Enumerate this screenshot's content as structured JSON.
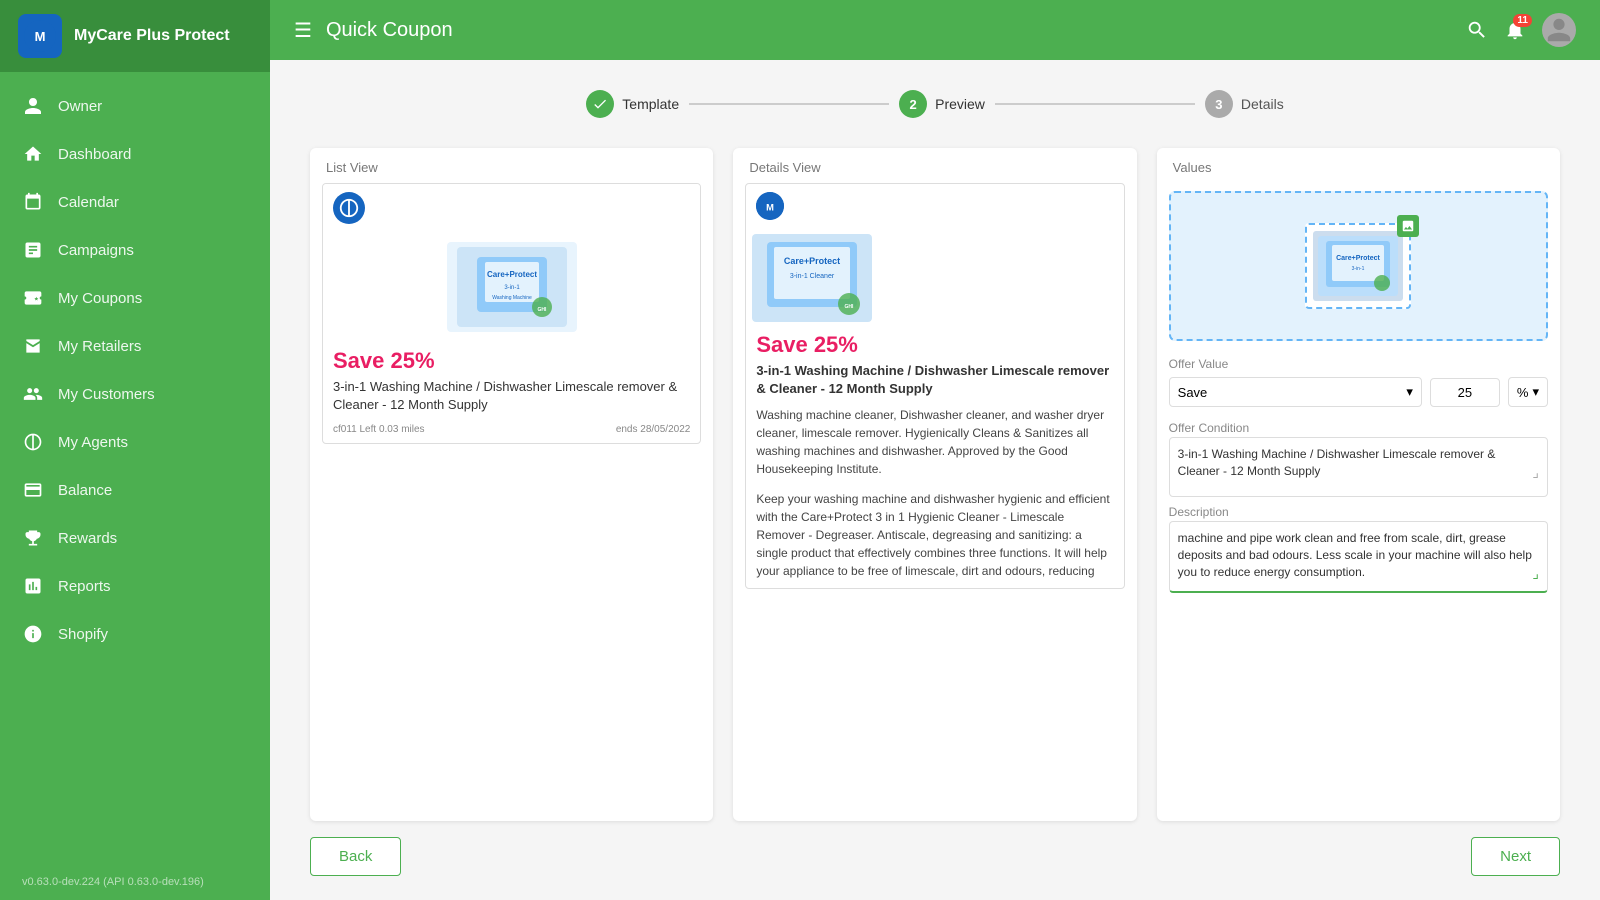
{
  "app": {
    "name": "MyCare Plus Protect",
    "logo_alt": "MyCare Plus logo"
  },
  "topbar": {
    "menu_icon": "☰",
    "title": "Quick Coupon",
    "notification_count": "11"
  },
  "sidebar": {
    "items": [
      {
        "id": "owner",
        "label": "Owner",
        "icon": "person"
      },
      {
        "id": "dashboard",
        "label": "Dashboard",
        "icon": "home"
      },
      {
        "id": "calendar",
        "label": "Calendar",
        "icon": "calendar"
      },
      {
        "id": "campaigns",
        "label": "Campaigns",
        "icon": "chart-bar"
      },
      {
        "id": "my-coupons",
        "label": "My Coupons",
        "icon": "tag"
      },
      {
        "id": "my-retailers",
        "label": "My Retailers",
        "icon": "store"
      },
      {
        "id": "my-customers",
        "label": "My Customers",
        "icon": "people"
      },
      {
        "id": "my-agents",
        "label": "My Agents",
        "icon": "person-group"
      },
      {
        "id": "balance",
        "label": "Balance",
        "icon": "credit-card"
      },
      {
        "id": "rewards",
        "label": "Rewards",
        "icon": "trophy"
      },
      {
        "id": "reports",
        "label": "Reports",
        "icon": "reports"
      },
      {
        "id": "shopify",
        "label": "Shopify",
        "icon": "shopify"
      }
    ],
    "version": "v0.63.0-dev.224 (API 0.63.0-dev.196)"
  },
  "stepper": {
    "steps": [
      {
        "number": "✓",
        "label": "Template",
        "state": "active"
      },
      {
        "number": "2",
        "label": "Preview",
        "state": "active"
      },
      {
        "number": "3",
        "label": "Details",
        "state": "inactive"
      }
    ]
  },
  "list_view": {
    "card_label": "List View",
    "save_text": "Save 25%",
    "product_title": "3-in-1 Washing Machine / Dishwasher Limescale remover & Cleaner - 12 Month Supply",
    "footer_left": "cf011  Left  0.03 miles",
    "footer_right": "ends 28/05/2022"
  },
  "details_view": {
    "card_label": "Details View",
    "save_text": "Save 25%",
    "product_title": "3-in-1 Washing Machine / Dishwasher Limescale remover & Cleaner - 12 Month Supply",
    "description_para1": "Washing machine cleaner, Dishwasher cleaner, and washer dryer cleaner, limescale remover. Hygienically Cleans & Sanitizes all washing machines and dishwasher. Approved by the Good Housekeeping Institute.",
    "description_para2": "Keep your washing machine and dishwasher hygienic and efficient with the Care+Protect 3 in 1 Hygienic Cleaner - Limescale Remover - Degreaser. Antiscale, degreasing and sanitizing: a single product that effectively combines three functions. It will help your appliance to be free of limescale, dirt and odours, reducing"
  },
  "values_view": {
    "card_label": "Values",
    "offer_value_label": "Offer Value",
    "offer_value_type": "Save",
    "offer_value_number": "25",
    "offer_value_unit": "%",
    "offer_condition_label": "Offer Condition",
    "offer_condition_text": "3-in-1 Washing Machine / Dishwasher Limescale remover & Cleaner - 12 Month Supply",
    "description_label": "Description",
    "description_text": "machine and pipe work clean and free from scale, dirt, grease deposits and bad odours. Less scale in your machine will also help you to reduce energy consumption."
  },
  "buttons": {
    "back": "Back",
    "next": "Next"
  }
}
